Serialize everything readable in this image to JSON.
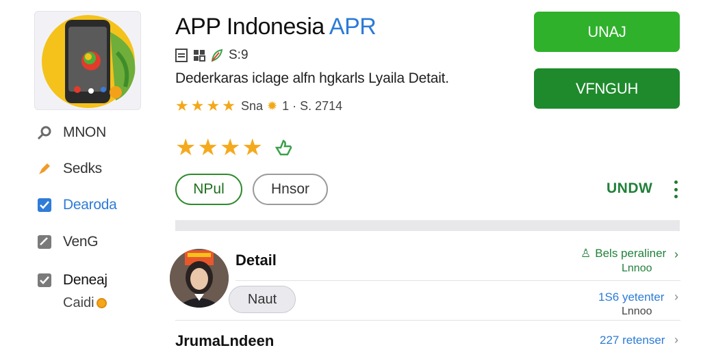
{
  "app": {
    "title_main": "APP Indonesia",
    "title_accent": "APR",
    "meta_value": "S:9",
    "description": "Dederkaras iclage alfn hgkarls Lyaila Detait.",
    "small_rating_text": "Sna",
    "small_rating_count": "1 · S. 2714"
  },
  "sidebar": {
    "items": [
      {
        "label": "MNON",
        "icon": "search-icon"
      },
      {
        "label": "Sedks",
        "icon": "pencil-icon"
      },
      {
        "label": "Dearoda",
        "icon": "checkbox-icon"
      },
      {
        "label": "VenG",
        "icon": "edit-icon"
      },
      {
        "label": "Deneaj",
        "icon": "checkbox-icon"
      }
    ],
    "extra_label": "Caidi"
  },
  "buttons": {
    "primary": "UNAJ",
    "secondary": "VFNGUH"
  },
  "pills": {
    "first": "NPul",
    "second": "Hnsor"
  },
  "link_undw": "UNDW",
  "list": {
    "detail_label": "Detail",
    "naut_button": "Naut",
    "section_label": "JrumaLndeen",
    "rows": [
      {
        "main": "Bels peraliner",
        "sub": "Lnnoo"
      },
      {
        "main": "1S6 yetenter",
        "sub": "Lnnoo"
      },
      {
        "main": "227 retenser",
        "sub": ""
      }
    ]
  },
  "colors": {
    "green_primary": "#2fb12b",
    "green_dark": "#1f8a2c",
    "accent_blue": "#2b7bd6",
    "star": "#f5a91c"
  }
}
